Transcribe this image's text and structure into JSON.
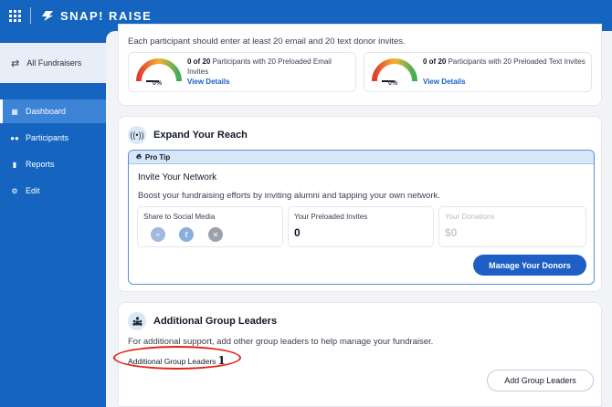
{
  "app": {
    "brand": "SNAP! RAISE",
    "icons": {
      "apps": "apps-grid-icon",
      "logo": "snap-logo-icon"
    },
    "colors": {
      "brand_blue": "#1565c0",
      "primary_button": "#1d5fc4",
      "link": "#1d5fc4",
      "annotation_red": "#e2251b"
    }
  },
  "sidebar": {
    "all_fundraisers": {
      "label": "All Fundraisers",
      "icon": "swap-arrows-icon"
    },
    "items": [
      {
        "label": "Dashboard",
        "icon": "dashboard-icon",
        "active": true
      },
      {
        "label": "Participants",
        "icon": "participants-icon",
        "active": false
      },
      {
        "label": "Reports",
        "icon": "bar-chart-icon",
        "active": false
      },
      {
        "label": "Edit",
        "icon": "gear-icon",
        "active": false
      }
    ]
  },
  "invites": {
    "description": "Each participant should enter at least 20 email and 20 text donor invites.",
    "stats": [
      {
        "prefix": "0 of 20",
        "text": " Participants with 20 Preloaded Email Invites",
        "percent_label": "0%",
        "percent": 0,
        "link": "View Details"
      },
      {
        "prefix": "0 of 20",
        "text": " Participants with 20 Preloaded Text Invites",
        "percent_label": "0%",
        "percent": 0,
        "link": "View Details"
      }
    ]
  },
  "reach": {
    "title": "Expand Your Reach",
    "icon": "broadcast-icon",
    "tip_label": "Pro Tip",
    "tip_icon": "flame-icon",
    "tip_title": "Invite Your Network",
    "tip_desc": "Boost your fundraising efforts by inviting alumni and tapping your own network.",
    "share": {
      "label": "Share to Social Media",
      "icons": [
        "messenger-icon",
        "facebook-icon",
        "x-icon"
      ]
    },
    "preloaded": {
      "label": "Your Preloaded Invites",
      "value": "0"
    },
    "donations": {
      "label": "Your Donations",
      "value": "$0"
    },
    "button": "Manage Your Donors"
  },
  "leaders": {
    "title": "Additional Group Leaders",
    "icon": "group-icon",
    "desc": "For additional support, add other group leaders to help manage your fundraiser.",
    "label": "Additional Group Leaders",
    "count": "1",
    "button": "Add Group Leaders"
  }
}
